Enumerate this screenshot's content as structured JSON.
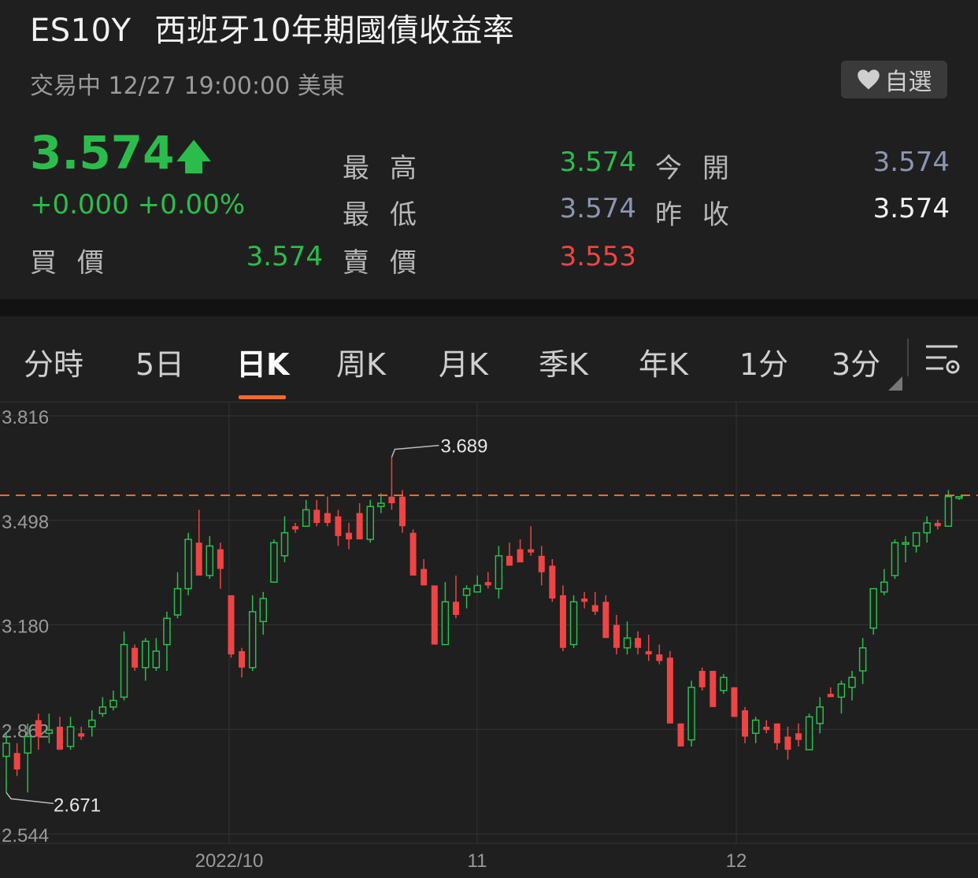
{
  "header": {
    "symbol": "ES10Y",
    "name": "西班牙10年期國債收益率",
    "status": "交易中 12/27 19:00:00 美東",
    "watch_label": "自選",
    "watch_icon": "heart-icon"
  },
  "quote": {
    "price": "3.574",
    "direction_icon": "arrow-up-icon",
    "change": "+0.000 +0.00%",
    "rows": [
      {
        "label": "最高",
        "value": "3.574",
        "color": "green"
      },
      {
        "label": "今開",
        "value": "3.574",
        "color": "gray"
      },
      {
        "label": "最低",
        "value": "3.574",
        "color": "gray"
      },
      {
        "label": "昨收",
        "value": "3.574",
        "color": "white"
      },
      {
        "label": "買價",
        "value": "3.574",
        "color": "green"
      },
      {
        "label": "賣價",
        "value": "3.553",
        "color": "red"
      }
    ]
  },
  "tabs": [
    "分時",
    "5日",
    "日K",
    "周K",
    "月K",
    "季K",
    "年K",
    "1分",
    "3分"
  ],
  "active_tab": "日K",
  "colors": {
    "up": "#2bbd4c",
    "down": "#ef4444",
    "reference_line": "#f2692d",
    "grid": "#333333"
  },
  "chart_data": {
    "type": "candlestick",
    "y_ticks": [
      "3.816",
      "3.498",
      "3.180",
      "2.862",
      "2.544"
    ],
    "ylim": [
      2.544,
      3.816
    ],
    "x_ticks": [
      "2022/10",
      "11",
      "12"
    ],
    "max_label": "3.689",
    "min_label": "2.671",
    "reference_value": 3.574,
    "candles": [
      [
        2.78,
        2.82,
        2.67,
        2.85
      ],
      [
        2.79,
        2.74,
        2.72,
        2.82
      ],
      [
        2.79,
        2.84,
        2.67,
        2.88
      ],
      [
        2.89,
        2.84,
        2.8,
        2.91
      ],
      [
        2.85,
        2.86,
        2.82,
        2.91
      ],
      [
        2.87,
        2.8,
        2.8,
        2.9
      ],
      [
        2.81,
        2.87,
        2.8,
        2.9
      ],
      [
        2.85,
        2.84,
        2.83,
        2.87
      ],
      [
        2.87,
        2.89,
        2.84,
        2.92
      ],
      [
        2.91,
        2.93,
        2.9,
        2.96
      ],
      [
        2.93,
        2.95,
        2.92,
        2.98
      ],
      [
        2.96,
        3.12,
        2.95,
        3.16
      ],
      [
        3.11,
        3.05,
        3.04,
        3.12
      ],
      [
        3.05,
        3.13,
        3.01,
        3.14
      ],
      [
        3.05,
        3.1,
        3.04,
        3.14
      ],
      [
        3.12,
        3.2,
        3.04,
        3.22
      ],
      [
        3.21,
        3.29,
        3.2,
        3.34
      ],
      [
        3.29,
        3.44,
        3.27,
        3.46
      ],
      [
        3.43,
        3.33,
        3.33,
        3.53
      ],
      [
        3.33,
        3.42,
        3.32,
        3.45
      ],
      [
        3.41,
        3.35,
        3.29,
        3.43
      ],
      [
        3.27,
        3.09,
        3.08,
        3.27
      ],
      [
        3.1,
        3.05,
        3.02,
        3.11
      ],
      [
        3.05,
        3.22,
        3.04,
        3.27
      ],
      [
        3.19,
        3.26,
        3.15,
        3.28
      ],
      [
        3.31,
        3.43,
        3.31,
        3.44
      ],
      [
        3.39,
        3.46,
        3.37,
        3.51
      ],
      [
        3.48,
        3.47,
        3.46,
        3.49
      ],
      [
        3.48,
        3.53,
        3.48,
        3.56
      ],
      [
        3.53,
        3.49,
        3.48,
        3.56
      ],
      [
        3.52,
        3.49,
        3.48,
        3.57
      ],
      [
        3.51,
        3.45,
        3.42,
        3.53
      ],
      [
        3.46,
        3.44,
        3.41,
        3.49
      ],
      [
        3.52,
        3.44,
        3.49,
        3.55
      ],
      [
        3.44,
        3.54,
        3.43,
        3.56
      ],
      [
        3.54,
        3.55,
        3.52,
        3.58
      ],
      [
        3.57,
        3.55,
        3.53,
        3.69
      ],
      [
        3.57,
        3.48,
        3.46,
        3.59
      ],
      [
        3.46,
        3.33,
        3.33,
        3.47
      ],
      [
        3.35,
        3.3,
        3.3,
        3.38
      ],
      [
        3.3,
        3.12,
        3.12,
        3.3
      ],
      [
        3.12,
        3.25,
        3.12,
        3.31
      ],
      [
        3.25,
        3.21,
        3.2,
        3.33
      ],
      [
        3.27,
        3.29,
        3.23,
        3.3
      ],
      [
        3.28,
        3.3,
        3.28,
        3.33
      ],
      [
        3.31,
        3.3,
        3.29,
        3.34
      ],
      [
        3.29,
        3.39,
        3.26,
        3.42
      ],
      [
        3.39,
        3.36,
        3.38,
        3.43
      ],
      [
        3.41,
        3.37,
        3.38,
        3.44
      ],
      [
        3.41,
        3.4,
        3.39,
        3.48
      ],
      [
        3.39,
        3.34,
        3.3,
        3.42
      ],
      [
        3.36,
        3.26,
        3.25,
        3.38
      ],
      [
        3.27,
        3.11,
        3.1,
        3.3
      ],
      [
        3.12,
        3.25,
        3.11,
        3.27
      ],
      [
        3.26,
        3.25,
        3.23,
        3.28
      ],
      [
        3.24,
        3.22,
        3.21,
        3.28
      ],
      [
        3.25,
        3.14,
        3.14,
        3.27
      ],
      [
        3.18,
        3.11,
        3.09,
        3.21
      ],
      [
        3.11,
        3.14,
        3.09,
        3.19
      ],
      [
        3.14,
        3.11,
        3.09,
        3.16
      ],
      [
        3.1,
        3.09,
        3.07,
        3.15
      ],
      [
        3.09,
        3.07,
        3.06,
        3.12
      ],
      [
        3.08,
        2.88,
        2.88,
        3.1
      ],
      [
        2.88,
        2.81,
        2.81,
        2.88
      ],
      [
        2.83,
        2.99,
        2.81,
        3.01
      ],
      [
        3.04,
        2.99,
        2.98,
        3.05
      ],
      [
        3.04,
        2.93,
        2.93,
        3.04
      ],
      [
        2.98,
        3.02,
        2.97,
        3.03
      ],
      [
        2.99,
        2.9,
        2.9,
        2.99
      ],
      [
        2.92,
        2.84,
        2.82,
        2.93
      ],
      [
        2.85,
        2.89,
        2.82,
        2.9
      ],
      [
        2.87,
        2.86,
        2.85,
        2.89
      ],
      [
        2.88,
        2.82,
        2.8,
        2.88
      ],
      [
        2.84,
        2.8,
        2.77,
        2.87
      ],
      [
        2.85,
        2.83,
        2.81,
        2.88
      ],
      [
        2.8,
        2.9,
        2.8,
        2.91
      ],
      [
        2.88,
        2.93,
        2.85,
        2.96
      ],
      [
        2.97,
        2.96,
        2.96,
        2.99
      ],
      [
        2.96,
        3.0,
        2.91,
        3.01
      ],
      [
        2.99,
        3.02,
        2.95,
        3.04
      ],
      [
        3.04,
        3.11,
        3.0,
        3.14
      ],
      [
        3.17,
        3.29,
        3.15,
        3.29
      ],
      [
        3.28,
        3.31,
        3.27,
        3.35
      ],
      [
        3.33,
        3.43,
        3.32,
        3.44
      ],
      [
        3.43,
        3.43,
        3.37,
        3.45
      ],
      [
        3.42,
        3.46,
        3.4,
        3.46
      ],
      [
        3.46,
        3.49,
        3.43,
        3.51
      ],
      [
        3.49,
        3.48,
        3.47,
        3.5
      ],
      [
        3.48,
        3.57,
        3.48,
        3.59
      ],
      [
        3.57,
        3.57,
        3.56,
        3.57
      ]
    ]
  }
}
